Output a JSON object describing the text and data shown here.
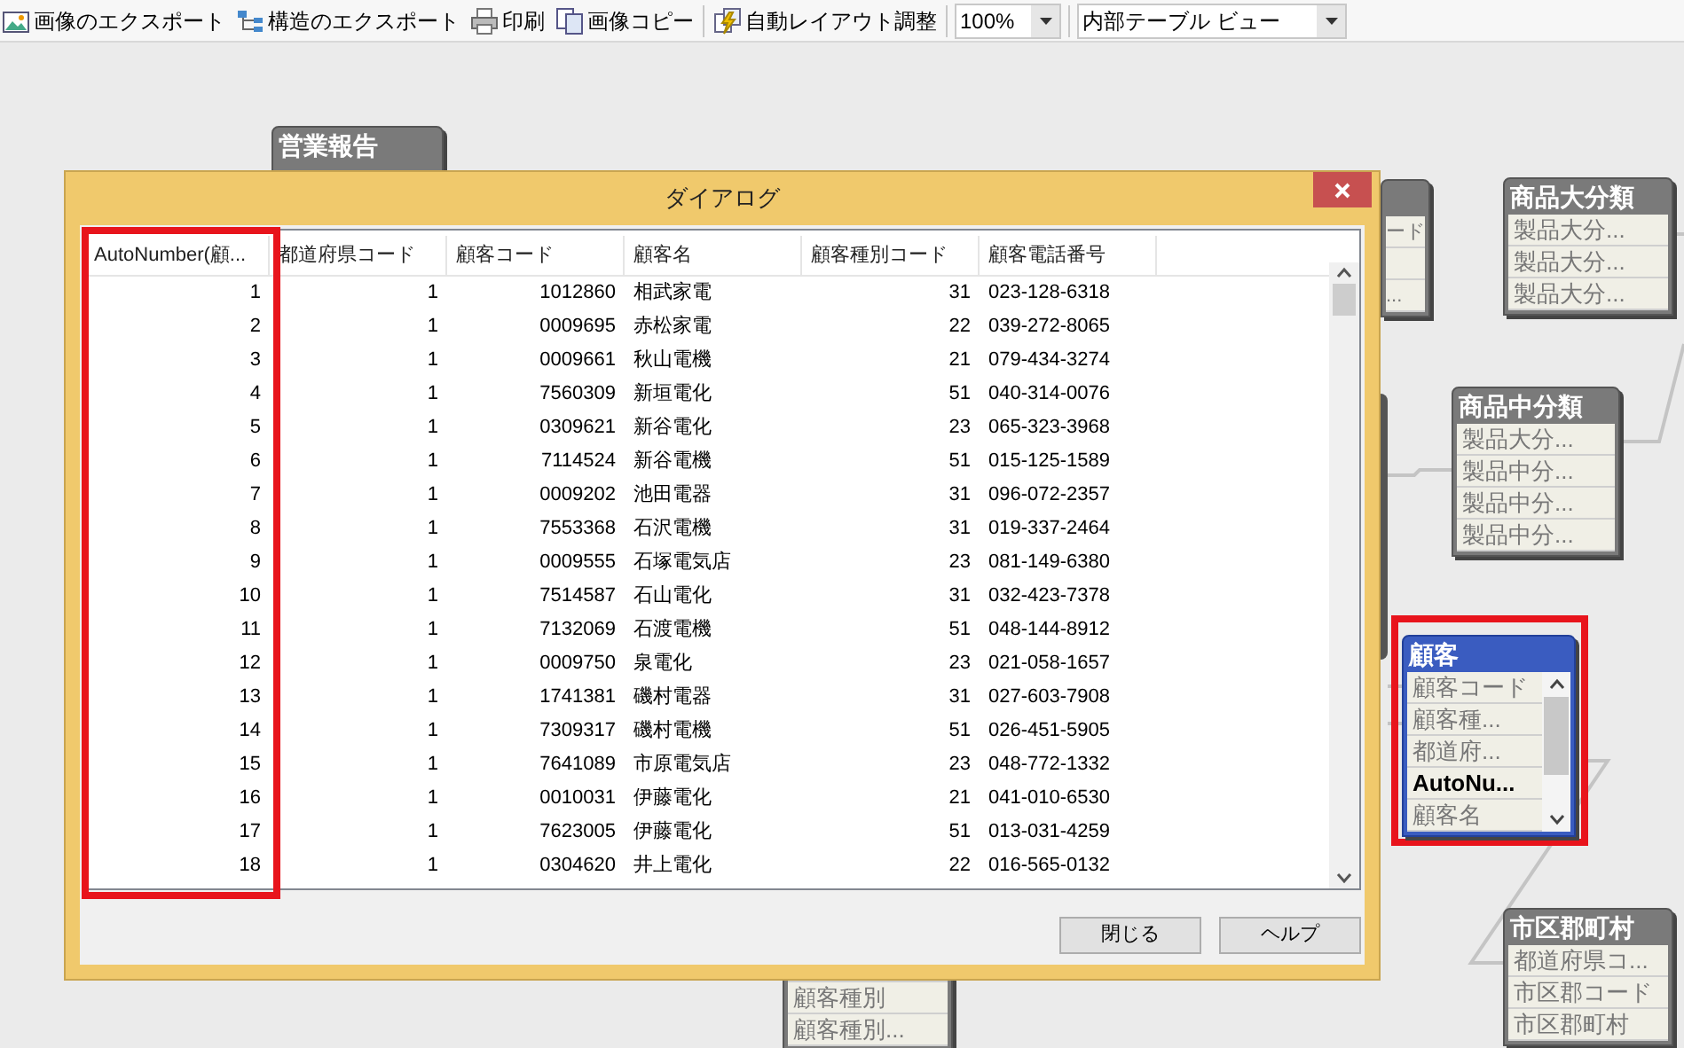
{
  "toolbar": {
    "buttons": [
      {
        "kind": "image",
        "label": "画像のエクスポート"
      },
      {
        "kind": "tree",
        "label": "構造のエクスポート"
      },
      {
        "kind": "print",
        "label": "印刷"
      },
      {
        "kind": "copy",
        "label": "画像コピー"
      },
      {
        "kind": "layout",
        "label": "自動レイアウト調整"
      }
    ],
    "zoom": "100%",
    "view": "内部テーブル ビュー"
  },
  "canvas": {
    "nodes": [
      {
        "kind": "normal",
        "title": "営業報告"
      },
      {
        "kind": "partial",
        "rows": [
          {
            "text": "ード",
            "bold": false
          },
          {
            "text": "...",
            "bold": false
          }
        ]
      },
      {
        "kind": "normal",
        "title": "商品大分類",
        "rows": [
          {
            "text": "製品大分...",
            "bold": false
          },
          {
            "text": "製品大分...",
            "bold": false
          },
          {
            "text": "製品大分...",
            "bold": false
          }
        ]
      },
      {
        "kind": "normal",
        "title": "商品中分類",
        "rows": [
          {
            "text": "製品大分...",
            "bold": false
          },
          {
            "text": "製品中分...",
            "bold": false
          },
          {
            "text": "製品中分...",
            "bold": false
          },
          {
            "text": "製品中分...",
            "bold": false
          }
        ]
      },
      {
        "kind": "selected",
        "title": "顧客",
        "highlighted": true,
        "rows": [
          {
            "text": "顧客コード",
            "bold": false
          },
          {
            "text": "顧客種...",
            "bold": false
          },
          {
            "text": "都道府...",
            "bold": false
          },
          {
            "text": "AutoNu...",
            "bold": true
          },
          {
            "text": "顧客名",
            "bold": false
          }
        ]
      },
      {
        "kind": "partial",
        "rows": [
          {
            "text": "顧客種別",
            "bold": false
          },
          {
            "text": "顧客種別...",
            "bold": false
          }
        ]
      },
      {
        "kind": "normal",
        "title": "市区郡町村",
        "rows": [
          {
            "text": "都道府県コ...",
            "bold": false
          },
          {
            "text": "市区郡コード",
            "bold": false
          },
          {
            "text": "市区郡町村",
            "bold": false
          }
        ]
      }
    ]
  },
  "dialog": {
    "title": "ダイアログ",
    "table": {
      "columns": [
        {
          "label": "AutoNumber(顧...",
          "highlighted": true
        },
        {
          "label": "都道府県コード",
          "highlighted": false
        },
        {
          "label": "顧客コード",
          "highlighted": false
        },
        {
          "label": "顧客名",
          "highlighted": false
        },
        {
          "label": "顧客種別コード",
          "highlighted": false
        },
        {
          "label": "顧客電話番号",
          "highlighted": false
        }
      ],
      "rows": [
        [
          "1",
          "1",
          "1012860",
          "相武家電",
          "31",
          "023-128-6318"
        ],
        [
          "2",
          "1",
          "0009695",
          "赤松家電",
          "22",
          "039-272-8065"
        ],
        [
          "3",
          "1",
          "0009661",
          "秋山電機",
          "21",
          "079-434-3274"
        ],
        [
          "4",
          "1",
          "7560309",
          "新垣電化",
          "51",
          "040-314-0076"
        ],
        [
          "5",
          "1",
          "0309621",
          "新谷電化",
          "23",
          "065-323-3968"
        ],
        [
          "6",
          "1",
          "7114524",
          "新谷電機",
          "51",
          "015-125-1589"
        ],
        [
          "7",
          "1",
          "0009202",
          "池田電器",
          "31",
          "096-072-2357"
        ],
        [
          "8",
          "1",
          "7553368",
          "石沢電機",
          "31",
          "019-337-2464"
        ],
        [
          "9",
          "1",
          "0009555",
          "石塚電気店",
          "23",
          "081-149-6380"
        ],
        [
          "10",
          "1",
          "7514587",
          "石山電化",
          "31",
          "032-423-7378"
        ],
        [
          "11",
          "1",
          "7132069",
          "石渡電機",
          "51",
          "048-144-8912"
        ],
        [
          "12",
          "1",
          "0009750",
          "泉電化",
          "23",
          "021-058-1657"
        ],
        [
          "13",
          "1",
          "1741381",
          "磯村電器",
          "31",
          "027-603-7908"
        ],
        [
          "14",
          "1",
          "7309317",
          "磯村電機",
          "51",
          "026-451-5905"
        ],
        [
          "15",
          "1",
          "7641089",
          "市原電気店",
          "23",
          "048-772-1332"
        ],
        [
          "16",
          "1",
          "0010031",
          "伊藤電化",
          "21",
          "041-010-6530"
        ],
        [
          "17",
          "1",
          "7623005",
          "伊藤電化",
          "51",
          "013-031-4259"
        ],
        [
          "18",
          "1",
          "0304620",
          "井上電化",
          "22",
          "016-565-0132"
        ]
      ]
    },
    "buttons": [
      "閉じる",
      "ヘルプ"
    ]
  }
}
